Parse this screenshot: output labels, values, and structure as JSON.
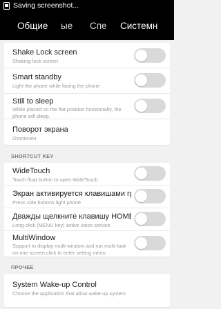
{
  "status_bar": {
    "text": "Saving screenshot..."
  },
  "tabs": [
    {
      "label": "Общие",
      "selected": false
    },
    {
      "label": "ые",
      "selected": false
    },
    {
      "label": "Спе",
      "selected": true
    },
    {
      "label": "Системн",
      "selected": false
    }
  ],
  "colors": {
    "accent": "#1fb236",
    "toggle_off": "#d9d9d9",
    "background": "#f1f1f1"
  },
  "settings_card_1": [
    {
      "title": "Shake Lock screen",
      "subtitle": "Shaking lock screen",
      "toggle": false
    },
    {
      "title": "Smart standby",
      "subtitle": "Light the phone while facing the phone",
      "toggle": false
    },
    {
      "title": "Still to sleep",
      "subtitle": "While placed on the flat position horizontally, the phone will sleep.",
      "toggle": false
    },
    {
      "title": "Поворот экрана",
      "subtitle": "Отключен"
    }
  ],
  "section_shortcut_key": "SHORTCUT KEY",
  "settings_card_2": [
    {
      "title": "WideTouch",
      "subtitle": "Touch float button to open WideTouch",
      "toggle": false
    },
    {
      "title": "Экран активируется клавишами гром",
      "subtitle": "Press side buttons light phone",
      "toggle": false
    },
    {
      "title": "Дважды щелкните клавишу HOME д",
      "subtitle": "Long-click (MENU key) active voice service",
      "toggle": false
    },
    {
      "title": "MultiWindow",
      "subtitle": "Support to display multi-window and run multi-task on one screen,click to enter setting menu",
      "toggle": false
    }
  ],
  "section_other": "ПРОЧЕЕ",
  "settings_card_3": [
    {
      "title": "System Wake-up Control",
      "subtitle": "Choose the application that allow wake-up system"
    }
  ]
}
